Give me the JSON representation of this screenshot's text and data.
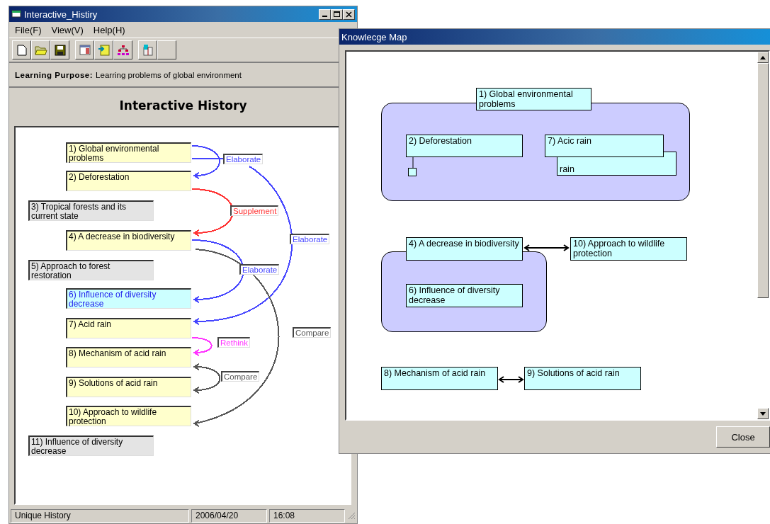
{
  "history_window": {
    "title": "Interactive_Histiry",
    "menu": [
      "File(F)",
      "View(V)",
      "Help(H)"
    ],
    "learning_purpose": {
      "label": "Learning Purpose:",
      "value": "Learring problems of global environment"
    },
    "heading": "Interactive History",
    "nodes": [
      {
        "text": "1) Global environmental problems",
        "kind": "visited"
      },
      {
        "text": "2) Deforestation",
        "kind": "visited"
      },
      {
        "text": "3) Tropical forests and its current state",
        "kind": "unvisited"
      },
      {
        "text": "4) A decrease in biodiversity",
        "kind": "visited"
      },
      {
        "text": "5) Approach to forest restoration",
        "kind": "unvisited"
      },
      {
        "text": "6) Influence of diversity decrease",
        "kind": "current"
      },
      {
        "text": "7) Acid rain",
        "kind": "visited"
      },
      {
        "text": "8) Mechanism of acid rain",
        "kind": "visited"
      },
      {
        "text": "9) Solutions of acid rain",
        "kind": "visited"
      },
      {
        "text": "10) Approach to wildlife protection",
        "kind": "visited"
      },
      {
        "text": "11) Influence of diversity decrease",
        "kind": "unvisited"
      }
    ],
    "links": [
      {
        "label": "Elaborate",
        "color": "#4444ff",
        "bidirectional": false
      },
      {
        "label": "Supplement",
        "color": "#ff3333",
        "bidirectional": false
      },
      {
        "label": "Elaborate",
        "color": "#4444ff",
        "bidirectional": false
      },
      {
        "label": "Elaborate",
        "color": "#4444ff",
        "bidirectional": false
      },
      {
        "label": "Compare",
        "color": "#555555",
        "bidirectional": false
      },
      {
        "label": "Rethink",
        "color": "#ff33ff",
        "bidirectional": false
      },
      {
        "label": "Compare",
        "color": "#555555",
        "bidirectional": true
      }
    ],
    "status_bar": [
      "Unique History",
      "2006/04/20",
      "16:08"
    ]
  },
  "map_window": {
    "title": "Knowlecge Map",
    "nodes": [
      {
        "text": "1) Global environmental problems"
      },
      {
        "text": "2) Deforestation"
      },
      {
        "text": "7) Acic rain"
      },
      {
        "text": "rain"
      },
      {
        "text": "4) A decrease in biodiversity"
      },
      {
        "text": "10) Approach to wildlife protection"
      },
      {
        "text": "6) Influence of diversity decrease"
      },
      {
        "text": "8) Mechanism of acid rain"
      },
      {
        "text": "9) Solutions of acid rain"
      }
    ],
    "close_button": "Close"
  }
}
